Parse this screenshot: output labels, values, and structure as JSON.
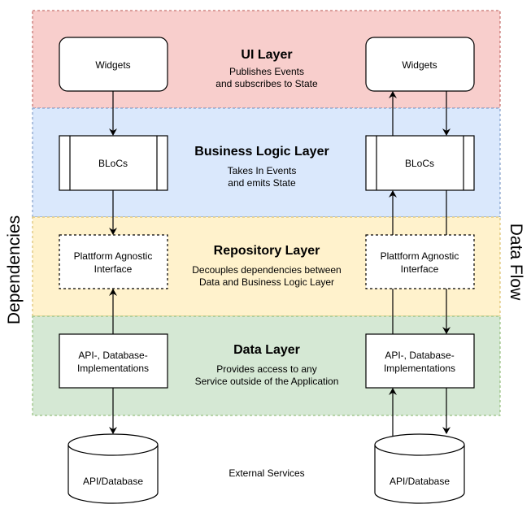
{
  "layers": [
    {
      "title": "UI Layer",
      "desc1": "Publishes Events",
      "desc2": "and subscribes to State",
      "fill": "#f8cecc",
      "stroke": "#b85450"
    },
    {
      "title": "Business Logic Layer",
      "desc1": "Takes In Events",
      "desc2": "and emits State",
      "fill": "#dae8fc",
      "stroke": "#6c8ebf"
    },
    {
      "title": "Repository Layer",
      "desc1": "Decouples dependencies between",
      "desc2": "Data and Business Logic Layer",
      "fill": "#fff2cc",
      "stroke": "#d6b656"
    },
    {
      "title": "Data Layer",
      "desc1": "Provides access to any",
      "desc2": "Service outside of the Application",
      "fill": "#d5e8d4",
      "stroke": "#82b366"
    }
  ],
  "boxes": {
    "widgets": "Widgets",
    "blocs": "BLoCs",
    "platform1": "Plattform Agnostic",
    "platform2": "Interface",
    "api1": "API-, Database-",
    "api2": "Implementations",
    "db": "API/Database"
  },
  "external": "External Services",
  "left_label": "Dependencies",
  "right_label": "Data Flow"
}
